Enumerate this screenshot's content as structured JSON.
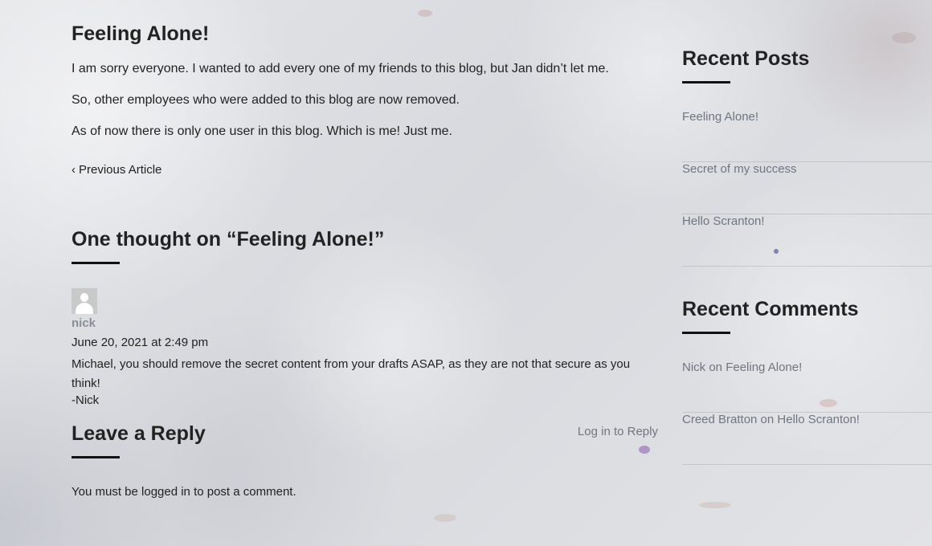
{
  "post": {
    "title": "Feeling Alone!",
    "paragraphs": [
      "I am sorry everyone. I wanted to add every one of my friends to this blog, but Jan didn’t let me.",
      "So, other employees who were added to this blog are now removed.",
      "As of now there is only one user in this blog. Which is me! Just me."
    ],
    "prev_article_label": "Previous Article"
  },
  "comments": {
    "heading_prefix": "One thought on “",
    "heading_post": "Feeling Alone!",
    "heading_suffix": "”",
    "items": [
      {
        "author": "nick",
        "date": "June 20, 2021 at 2:49 pm",
        "text": "Michael, you should remove the secret content from your drafts ASAP, as they are not that secure as you think!",
        "signature": "-Nick",
        "reply_label": "Log in to Reply"
      }
    ]
  },
  "reply": {
    "title": "Leave a Reply",
    "must_prefix": "You must be ",
    "login_link": "logged in",
    "must_suffix": " to post a comment."
  },
  "sidebar": {
    "recent_posts_title": "Recent Posts",
    "recent_posts": [
      "Feeling Alone!",
      "Secret of my success",
      "Hello Scranton!"
    ],
    "recent_comments_title": "Recent Comments",
    "recent_comments": [
      {
        "author": "Nick",
        "on": " on ",
        "post": "Feeling Alone!"
      },
      {
        "author": "Creed Bratton",
        "on": " on ",
        "post": "Hello Scranton!"
      }
    ]
  },
  "icons": {
    "prev": "chevron-left-icon",
    "avatar": "default-avatar-icon"
  }
}
